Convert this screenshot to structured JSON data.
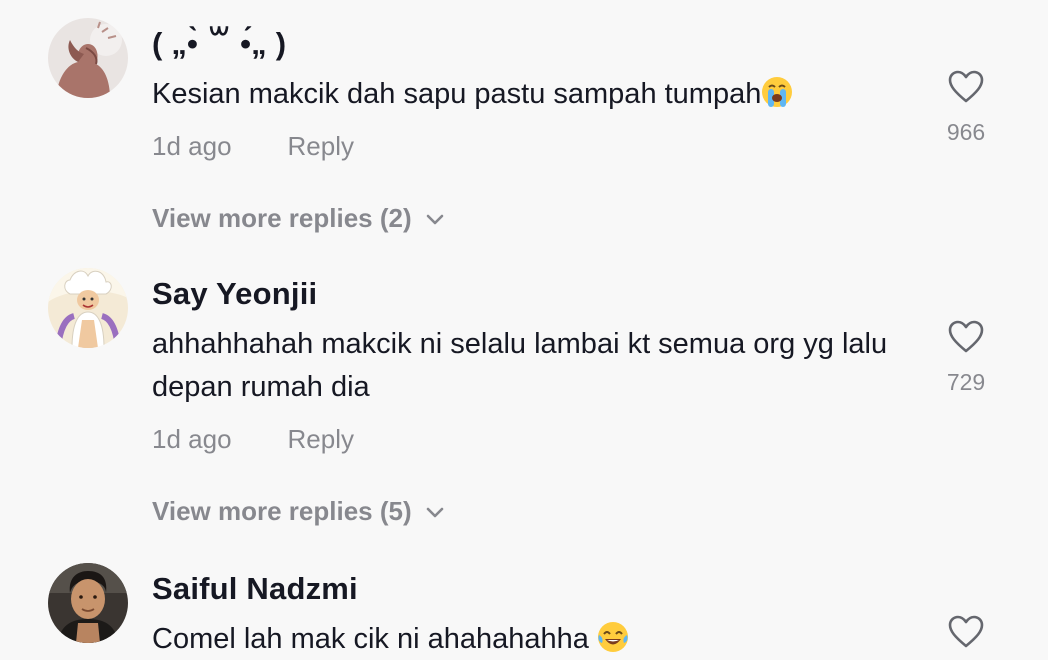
{
  "comments": [
    {
      "username": "( „•̀ ꒳ •́„ )",
      "text": "Kesian makcik dah sapu pastu sampah tumpah",
      "emoji": "loudly-crying-face-emoji",
      "time": "1d ago",
      "reply_label": "Reply",
      "likes": "966",
      "more_replies": "View more replies (2)"
    },
    {
      "username": "Say Yeonjii",
      "text": "ahhahhahah makcik ni selalu lambai kt semua org yg lalu depan rumah dia",
      "time": "1d ago",
      "reply_label": "Reply",
      "likes": "729",
      "more_replies": "View more replies (5)"
    },
    {
      "username": "Saiful Nadzmi",
      "text": "Comel lah mak cik ni ahahahahha ",
      "emoji": "face-with-tears-of-joy-emoji"
    }
  ],
  "icons": {
    "like": "heart-outline-icon",
    "expand": "chevron-down-icon"
  },
  "colors": {
    "background": "#f8f8f8",
    "text_primary": "#161823",
    "text_secondary": "rgba(22,24,35,0.5)"
  }
}
